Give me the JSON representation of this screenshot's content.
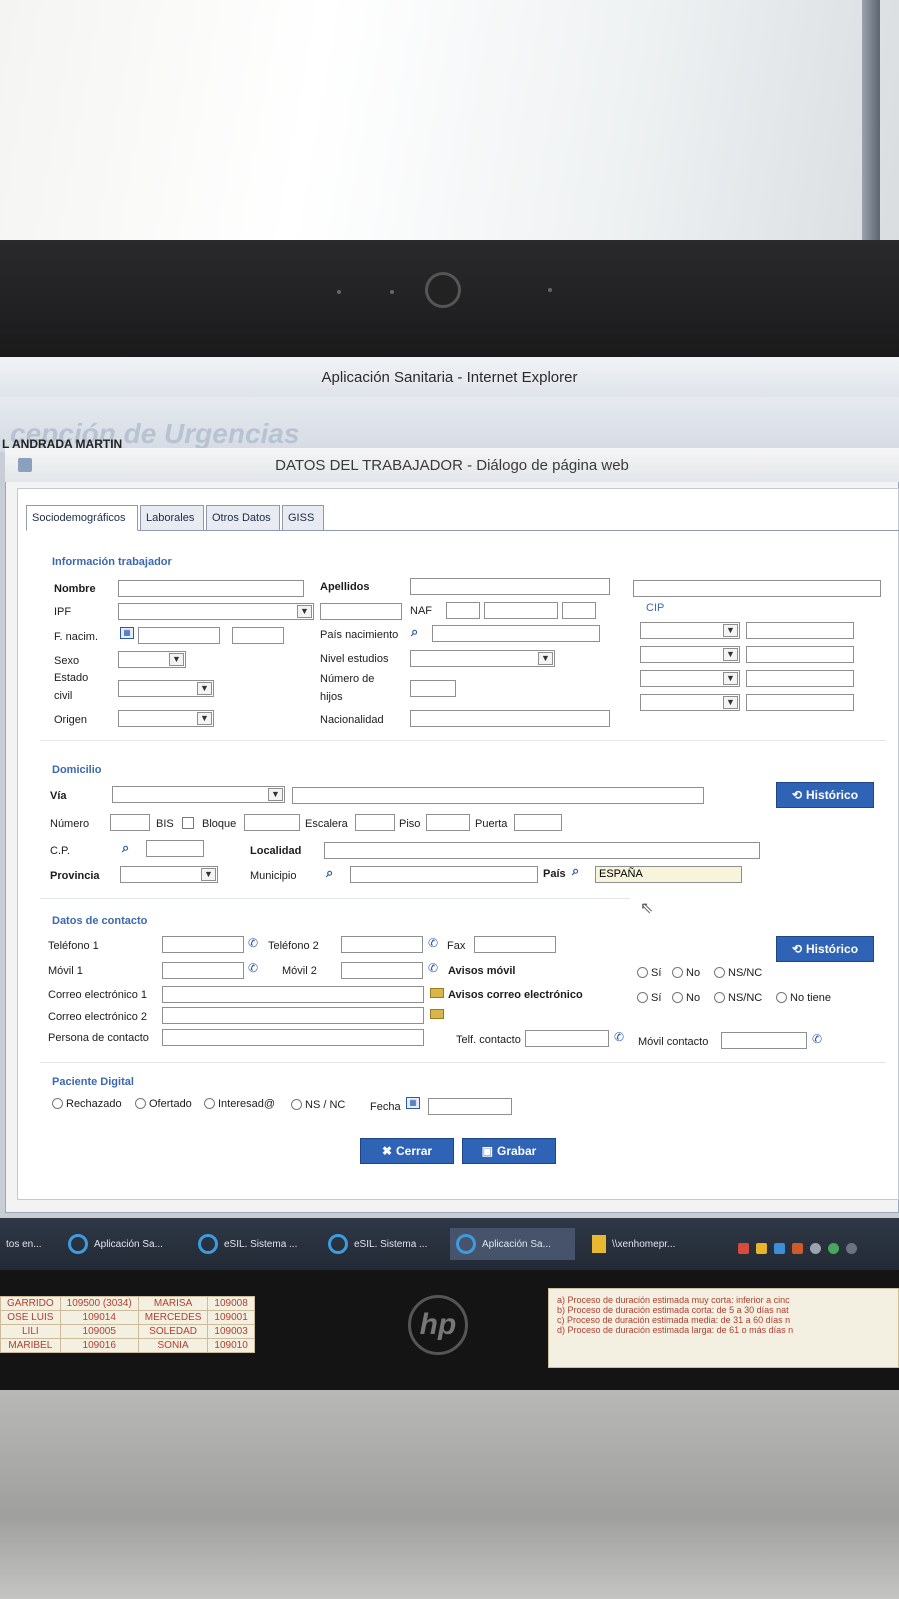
{
  "window": {
    "title": "Aplicación Sanitaria - Internet Explorer"
  },
  "background_app": {
    "title": "cepción de Urgencias",
    "user": "L ANDRADA MARTIN"
  },
  "dialog": {
    "title": "DATOS DEL TRABAJADOR - Diálogo de página web",
    "tabs": [
      "Sociodemográficos",
      "Laborales",
      "Otros Datos",
      "GISS"
    ],
    "info": {
      "section": "Información trabajador",
      "nombre": "Nombre",
      "apellidos": "Apellidos",
      "ipf": "IPF",
      "naf": "NAF",
      "cip": "CIP",
      "fnacim": "F. nacim.",
      "pais_nacimiento": "País nacimiento",
      "sexo": "Sexo",
      "nivel_estudios": "Nivel estudios",
      "estado": "Estado",
      "civil": "civil",
      "numero_de": "Número de",
      "hijos": "hijos",
      "origen": "Origen",
      "nacionalidad": "Nacionalidad"
    },
    "domicilio": {
      "section": "Domicilio",
      "via": "Vía",
      "numero": "Número",
      "bis": "BIS",
      "bloque": "Bloque",
      "escalera": "Escalera",
      "piso": "Piso",
      "puerta": "Puerta",
      "cp": "C.P.",
      "localidad": "Localidad",
      "provincia": "Provincia",
      "municipio": "Municipio",
      "pais": "País",
      "pais_value": "ESPAÑA",
      "historico": "Histórico"
    },
    "contacto": {
      "section": "Datos de contacto",
      "telefono1": "Teléfono 1",
      "telefono2": "Teléfono 2",
      "fax": "Fax",
      "movil1": "Móvil 1",
      "movil2": "Móvil 2",
      "avisos_movil": "Avisos móvil",
      "correo1": "Correo electrónico 1",
      "correo2": "Correo electrónico 2",
      "avisos_correo": "Avisos correo electrónico",
      "persona": "Persona de contacto",
      "telf_contacto": "Telf. contacto",
      "movil_contacto": "Móvil contacto",
      "historico": "Histórico",
      "opt_si": "Sí",
      "opt_no": "No",
      "opt_nsnc": "NS/NC",
      "opt_no_tiene": "No tiene"
    },
    "digital": {
      "section": "Paciente Digital",
      "rechazado": "Rechazado",
      "ofertado": "Ofertado",
      "interesado": "Interesad@",
      "nsnc": "NS / NC",
      "fecha": "Fecha"
    },
    "buttons": {
      "cerrar": "Cerrar",
      "grabar": "Grabar"
    }
  },
  "taskbar": {
    "items": [
      "tos en...",
      "Aplicación Sa...",
      "eSIL. Sistema ...",
      "eSIL. Sistema ...",
      "Aplicación Sa...",
      "\\\\xenhomepr..."
    ]
  },
  "paper_table": {
    "rows": [
      [
        "GARRIDO",
        "109500 (3034)",
        "MARISA",
        "109008"
      ],
      [
        "OSE LUIS",
        "109014",
        "MERCEDES",
        "109001"
      ],
      [
        "LILI",
        "109005",
        "SOLEDAD",
        "109003"
      ],
      [
        "MARIBEL",
        "109016",
        "SONIA",
        "109010"
      ]
    ]
  },
  "paper_note": {
    "lines": [
      "a)  Proceso de duración estimada muy corta: inferior a cinc",
      "b)  Proceso de duración estimada corta: de 5 a 30 días nat",
      "c)  Proceso de duración estimada media: de 31 a 60 días n",
      "d)  Proceso de duración estimada larga: de 61 o más días n"
    ]
  },
  "colors": {
    "accent": "#2f63b5",
    "section": "#3b68b0"
  }
}
